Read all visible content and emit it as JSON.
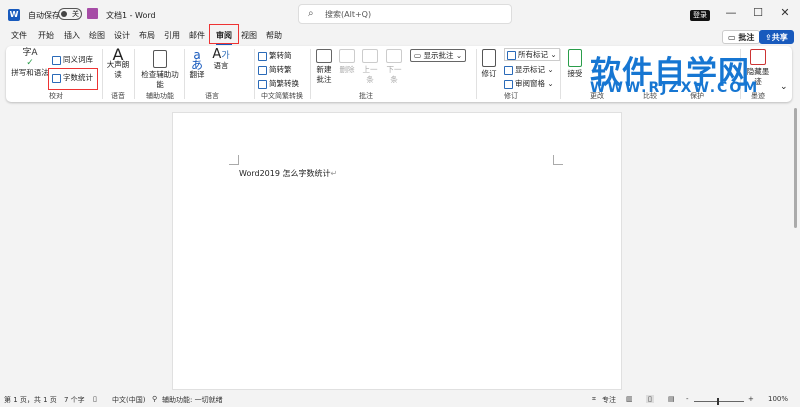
{
  "titlebar": {
    "autosave_label": "自动保存",
    "autosave_state": "关",
    "doc_title": "文档1 - Word",
    "search_placeholder": "搜索(Alt+Q)",
    "login": "登录",
    "minimize": "—",
    "maximize": "☐",
    "close": "✕"
  },
  "tabs": [
    "文件",
    "开始",
    "插入",
    "绘图",
    "设计",
    "布局",
    "引用",
    "邮件",
    "审阅",
    "视图",
    "帮助"
  ],
  "active_tab": "审阅",
  "top_buttons": {
    "comments": "批注",
    "share": "共享"
  },
  "ribbon": {
    "proofing": {
      "spell": "拼写和语法",
      "thesaurus": "同义词库",
      "word_count": "字数统计",
      "label": "校对"
    },
    "speech": {
      "read_aloud": "大声朗读",
      "label": "语音"
    },
    "accessibility": {
      "check": "检查辅助功能",
      "label": "辅助功能"
    },
    "language": {
      "translate": "翻译",
      "language": "语言",
      "label": "语言"
    },
    "chinese_conv": {
      "t2s": "繁转简",
      "s2t": "简转繁",
      "conv": "简繁转换",
      "label": "中文简繁转换"
    },
    "comments": {
      "new": "新建批注",
      "delete": "删除",
      "prev": "上一条",
      "next": "下一条",
      "show": "显示批注",
      "label": "批注"
    },
    "tracking": {
      "track": "修订",
      "all_markup": "所有标记",
      "show_markup": "显示标记",
      "pane": "审阅窗格",
      "label": "修订"
    },
    "changes": {
      "accept": "接受",
      "label": "更改"
    },
    "compare": {
      "label": "比较"
    },
    "protect": {
      "label": "保护"
    },
    "ink": {
      "hide": "隐藏墨迹",
      "label": "墨迹"
    }
  },
  "watermark": {
    "title": "软件自学网",
    "url": "WWW.RJZXW.COM"
  },
  "document": {
    "text": "Word2019 怎么字数统计"
  },
  "status": {
    "page": "第 1 页，共 1 页",
    "words": "7 个字",
    "lang": "中文(中国)",
    "access": "辅助功能: 一切就绪",
    "focus": "专注",
    "zoom": "100%",
    "zoom_minus": "-",
    "zoom_plus": "+"
  }
}
